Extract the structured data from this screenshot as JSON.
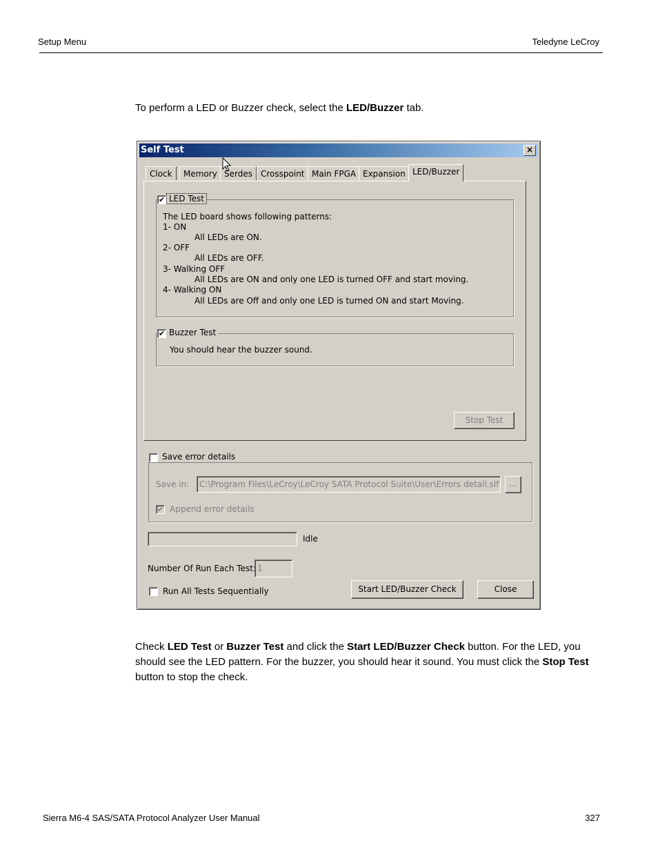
{
  "page_header": {
    "left": "Setup Menu",
    "right": "Teledyne LeCroy"
  },
  "intro": {
    "before": "To perform a LED or Buzzer check, select the ",
    "bold": "LED/Buzzer",
    "after": " tab."
  },
  "dialog": {
    "title": "Self Test",
    "close_glyph": "×",
    "tabs": [
      {
        "label": "Clock",
        "active": false
      },
      {
        "label": "Memory",
        "active": false
      },
      {
        "label": "Serdes",
        "active": false
      },
      {
        "label": "Crosspoint",
        "active": false
      },
      {
        "label": "Main FPGA",
        "active": false
      },
      {
        "label": "Expansion",
        "active": false
      },
      {
        "label": "LED/Buzzer",
        "active": true
      }
    ],
    "led_test": {
      "label": "LED Test",
      "checked": true,
      "lines": [
        "The LED board shows following patterns:",
        "1- ON",
        "All LEDs are ON.",
        "2- OFF",
        "All LEDs are OFF.",
        "3- Walking OFF",
        "All LEDs are ON and only one LED is turned OFF and start moving.",
        "4- Walking ON",
        "All LEDs are Off and only one LED is turned ON and start Moving."
      ]
    },
    "buzzer_test": {
      "label": "Buzzer Test",
      "checked": true,
      "text": "You should hear the buzzer sound."
    },
    "stop_test_label": "Stop Test",
    "save_error": {
      "label": "Save error details",
      "checked": false,
      "save_in_label": "Save in:",
      "path": "C:\\Program Files\\LeCroy\\LeCroy SATA Protocol Suite\\User\\Errors detail.slf",
      "browse_label": "...",
      "append_label": "Append error details",
      "append_checked": true
    },
    "progress": {
      "value_percent": 0,
      "status": "Idle"
    },
    "runs": {
      "label": "Number Of Run Each Test:",
      "value": "1"
    },
    "run_all": {
      "label": "Run All Tests Sequentially",
      "checked": false
    },
    "start_label": "Start LED/Buzzer Check",
    "close_label": "Close",
    "check_glyph": "✔"
  },
  "body_text": {
    "p1": "Check ",
    "b1": "LED Test",
    "p2": " or ",
    "b2": "Buzzer Test",
    "p3": " and click the ",
    "b3": "Start LED/Buzzer Check",
    "p4": " button. For the LED, you should see the LED pattern. For the buzzer, you should hear it sound. You must click the ",
    "b4": "Stop Test",
    "p5": " button to stop the check."
  },
  "page_footer": {
    "left": "Sierra M6-4 SAS/SATA Protocol Analyzer User Manual",
    "right": "327"
  }
}
